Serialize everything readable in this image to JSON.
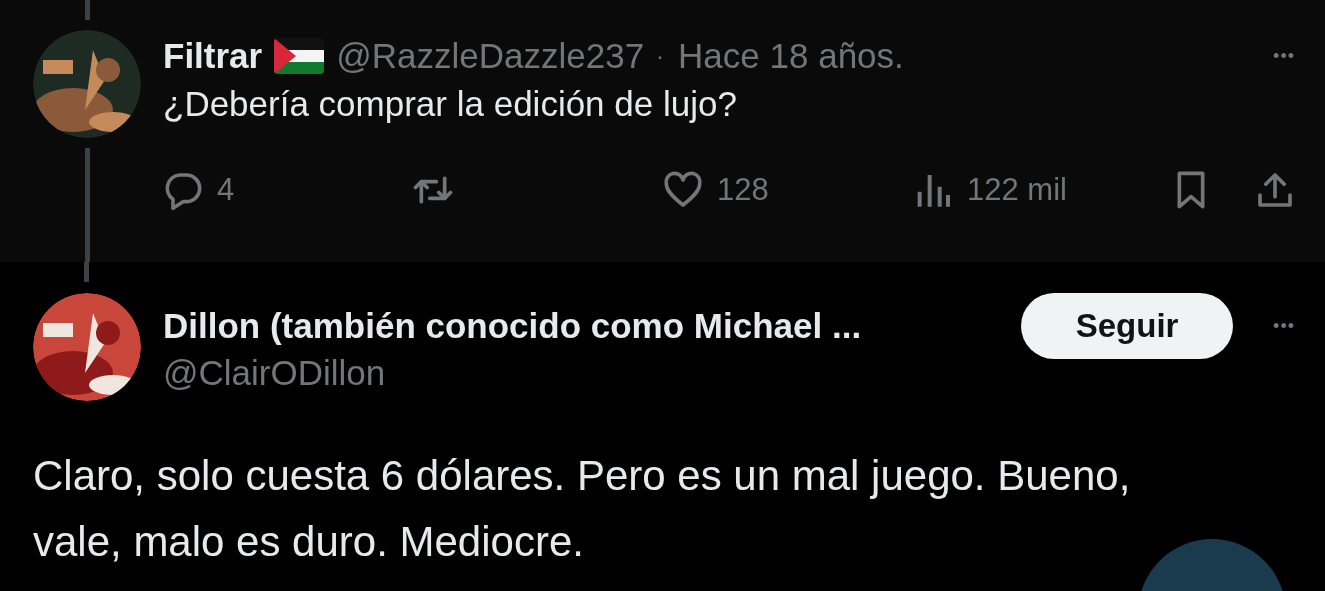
{
  "parent_tweet": {
    "name": "Filtrar",
    "handle": "@RazzleDazzle237",
    "separator": "·",
    "time": "Hace 18 años.",
    "more": "•••",
    "text": "¿Debería comprar la edición de lujo?",
    "actions": [
      {
        "kind": "reply",
        "count": "4"
      },
      {
        "kind": "repost"
      },
      {
        "kind": "like",
        "count": "128"
      },
      {
        "kind": "views",
        "count": "122 mil"
      }
    ]
  },
  "reply_tweet": {
    "name": "Dillon (también conocido como Michael ...",
    "handle": "@ClairODillon",
    "follow_button": "Seguir",
    "more": "•••",
    "text": "Claro, solo cuesta 6 dólares. Pero es un mal juego. Bueno, vale, malo es duro. Mediocre."
  }
}
